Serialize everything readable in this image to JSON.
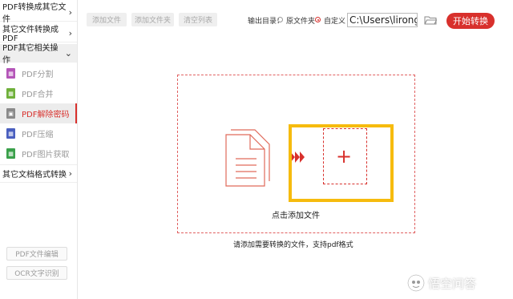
{
  "sidebar": {
    "categories": [
      {
        "label": "PDF转换成其它文件",
        "chevron": "›"
      },
      {
        "label": "其它文件转换成PDF",
        "chevron": "›"
      },
      {
        "label": "PDF其它相关操作",
        "chevron": "⌄"
      },
      {
        "label": "其它文档格式转换",
        "chevron": "›"
      }
    ],
    "sub_items": [
      {
        "label": "PDF分割",
        "icon": "split-icon",
        "color": "#b455b8"
      },
      {
        "label": "PDF合并",
        "icon": "merge-icon",
        "color": "#6fb03a"
      },
      {
        "label": "PDF解除密码",
        "icon": "unlock-icon",
        "color": "#8a8a8a"
      },
      {
        "label": "PDF压缩",
        "icon": "compress-icon",
        "color": "#4a5fbf"
      },
      {
        "label": "PDF图片获取",
        "icon": "image-extract-icon",
        "color": "#3aa04a"
      }
    ],
    "bottom_buttons": [
      {
        "label": "PDF文件编辑"
      },
      {
        "label": "OCR文字识别"
      }
    ]
  },
  "toolbar": {
    "add_file": "添加文件",
    "add_folder": "添加文件夹",
    "clear_list": "清空列表",
    "output_label": "输出目录：",
    "option_original": "原文件夹",
    "option_custom": "自定义",
    "path_value": "C:\\Users\\lirongyu",
    "start_button": "开始转换",
    "accent_color": "#d8302c"
  },
  "main": {
    "click_add": "点击添加文件",
    "hint": "请添加需要转换的文件，支持pdf格式",
    "highlight_color": "#f6bb0e"
  },
  "watermark": {
    "text": "悟空问答"
  }
}
